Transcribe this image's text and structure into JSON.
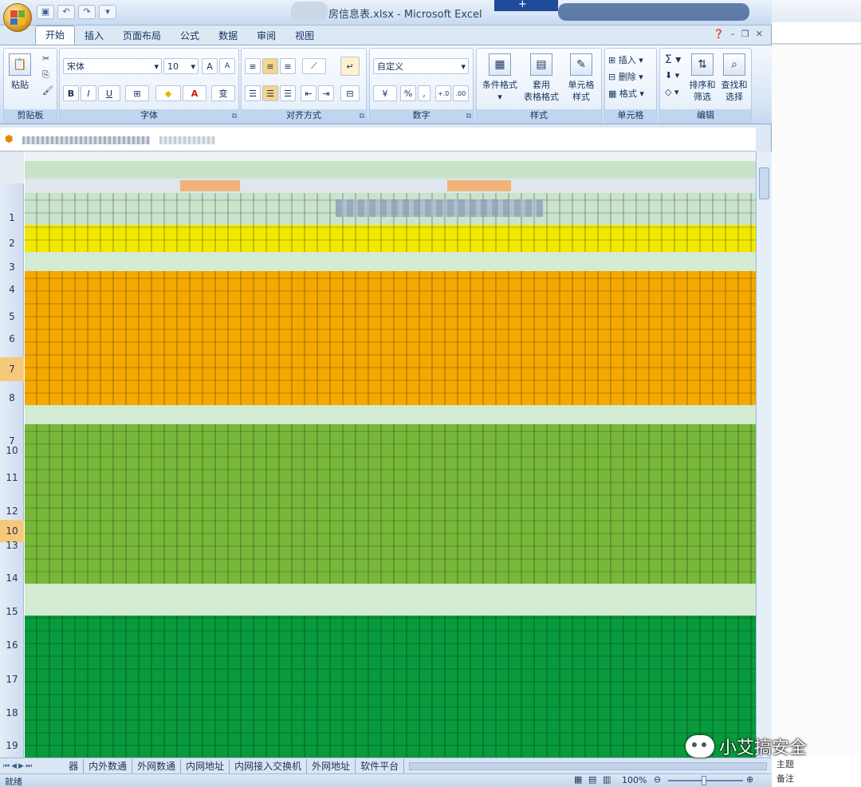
{
  "window": {
    "title": "房信息表.xlsx - Microsoft Excel"
  },
  "tabs": [
    "开始",
    "插入",
    "页面布局",
    "公式",
    "数据",
    "审阅",
    "视图"
  ],
  "clipboard": {
    "paste": "粘贴",
    "group": "剪贴板"
  },
  "font": {
    "name": "宋体",
    "size": "10",
    "group": "字体",
    "bold": "B",
    "italic": "I",
    "underline": "U",
    "grow": "A",
    "shrink": "A",
    "wen": "变"
  },
  "alignment": {
    "group": "对齐方式"
  },
  "number": {
    "format": "自定义",
    "group": "数字",
    "percent": "%"
  },
  "styles": {
    "cond": "条件格式",
    "table1": "套用",
    "table2": "表格格式",
    "cell1": "单元格",
    "cell2": "样式",
    "group": "样式"
  },
  "cells": {
    "insert": "插入",
    "delete": "删除",
    "format": "格式",
    "group": "单元格"
  },
  "editing": {
    "sort1": "排序和",
    "sort2": "筛选",
    "find1": "查找和",
    "find2": "选择",
    "group": "编辑"
  },
  "rows": [
    "1",
    "2",
    "3",
    "4",
    "5",
    "6",
    "7",
    "8",
    "7",
    "10",
    "11",
    "12",
    "10",
    "13",
    "14",
    "15",
    "16",
    "17",
    "18",
    "19"
  ],
  "sheets": [
    "器",
    "内外数通",
    "外网数通",
    "内网地址",
    "内网接入交换机",
    "外网地址",
    "软件平台"
  ],
  "status": {
    "ready": "就绪",
    "zoom": "100%"
  },
  "side": {
    "a": "主题",
    "b": "备注"
  },
  "watermark": "小艾搞安全",
  "colors": {
    "yellow": "#f2e800",
    "orange": "#f4a800",
    "lightgreen": "#77b83a",
    "darkgreen": "#089a3c",
    "pale": "#cfe7cf"
  }
}
